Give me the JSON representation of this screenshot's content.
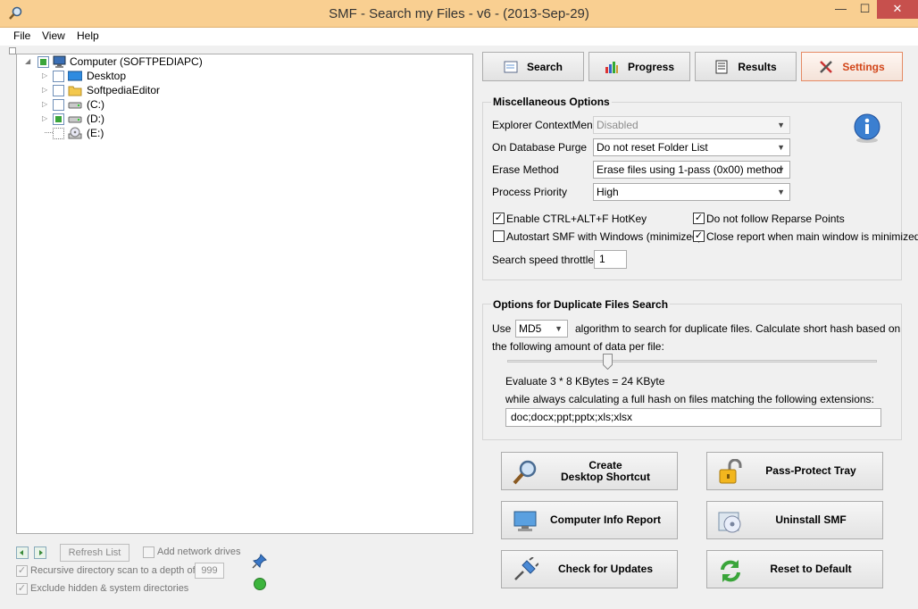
{
  "window": {
    "title": "SMF - Search my Files - v6 - (2013-Sep-29)",
    "controls": {
      "minimize": "—",
      "maximize": "☐",
      "close": "✕"
    }
  },
  "menu": {
    "items": [
      "File",
      "View",
      "Help"
    ]
  },
  "tree": {
    "nodes": [
      {
        "label": "Computer (SOFTPEDIAPC)",
        "icon": "computer-icon",
        "state": "partial"
      },
      {
        "label": "Desktop",
        "icon": "desktop-icon",
        "state": "unchecked"
      },
      {
        "label": "SoftpediaEditor",
        "icon": "folder-icon",
        "state": "unchecked"
      },
      {
        "label": "(C:)",
        "icon": "drive-icon",
        "state": "unchecked"
      },
      {
        "label": "(D:)",
        "icon": "drive-icon",
        "state": "partial"
      },
      {
        "label": "(E:)",
        "icon": "cd-drive-icon",
        "state": "unchecked"
      }
    ]
  },
  "bottom_left": {
    "refresh_label": "Refresh List",
    "add_network_label": "Add network drives",
    "recursive_label": "Recursive directory scan to a depth of",
    "depth_value": "999",
    "exclude_label": "Exclude hidden & system directories",
    "status_color": "#3cb43c"
  },
  "tabs": [
    {
      "label": "Search",
      "icon": "search-tab-icon",
      "active": false
    },
    {
      "label": "Progress",
      "icon": "progress-tab-icon",
      "active": false
    },
    {
      "label": "Results",
      "icon": "results-tab-icon",
      "active": false
    },
    {
      "label": "Settings",
      "icon": "settings-tab-icon",
      "active": true
    }
  ],
  "misc": {
    "title": "Miscellaneous Options",
    "explorer_label": "Explorer ContextMenu",
    "explorer_value": "Disabled",
    "purge_label": "On Database Purge",
    "purge_value": "Do not reset Folder List",
    "erase_label": "Erase Method",
    "erase_value": "Erase files using 1-pass (0x00) method",
    "priority_label": "Process Priority",
    "priority_value": "High",
    "ctrl_alt_f_label": "Enable CTRL+ALT+F HotKey",
    "ctrl_alt_f_checked": true,
    "reparse_label": "Do not follow Reparse Points",
    "reparse_checked": true,
    "autostart_label": "Autostart SMF with Windows (minimized)",
    "autostart_checked": false,
    "close_report_label": "Close report when main window is minimized",
    "close_report_checked": true,
    "throttle_label": "Search speed throttle",
    "throttle_value": "1"
  },
  "dup": {
    "title": "Options for Duplicate Files Search",
    "use_label": "Use",
    "algo_value": "MD5",
    "algo_text": "algorithm to search for duplicate files. Calculate short hash based on",
    "algo_text2": "the following amount of data per file:",
    "slider_fraction": 0.27,
    "evaluate_text": "Evaluate 3 * 8 KBytes = 24 KByte",
    "extensions_text": "while always calculating a full hash on files matching the following extensions:",
    "extensions_value": "doc;docx;ppt;pptx;xls;xlsx"
  },
  "actions": {
    "create_shortcut": "Create\nDesktop Shortcut",
    "pass_protect": "Pass-Protect Tray",
    "computer_info": "Computer Info Report",
    "uninstall": "Uninstall SMF",
    "check_updates": "Check for Updates",
    "reset_default": "Reset to Default"
  },
  "colors": {
    "titlebar": "#f9cf91",
    "active_tab": "#d2461a",
    "close": "#c7504d"
  }
}
